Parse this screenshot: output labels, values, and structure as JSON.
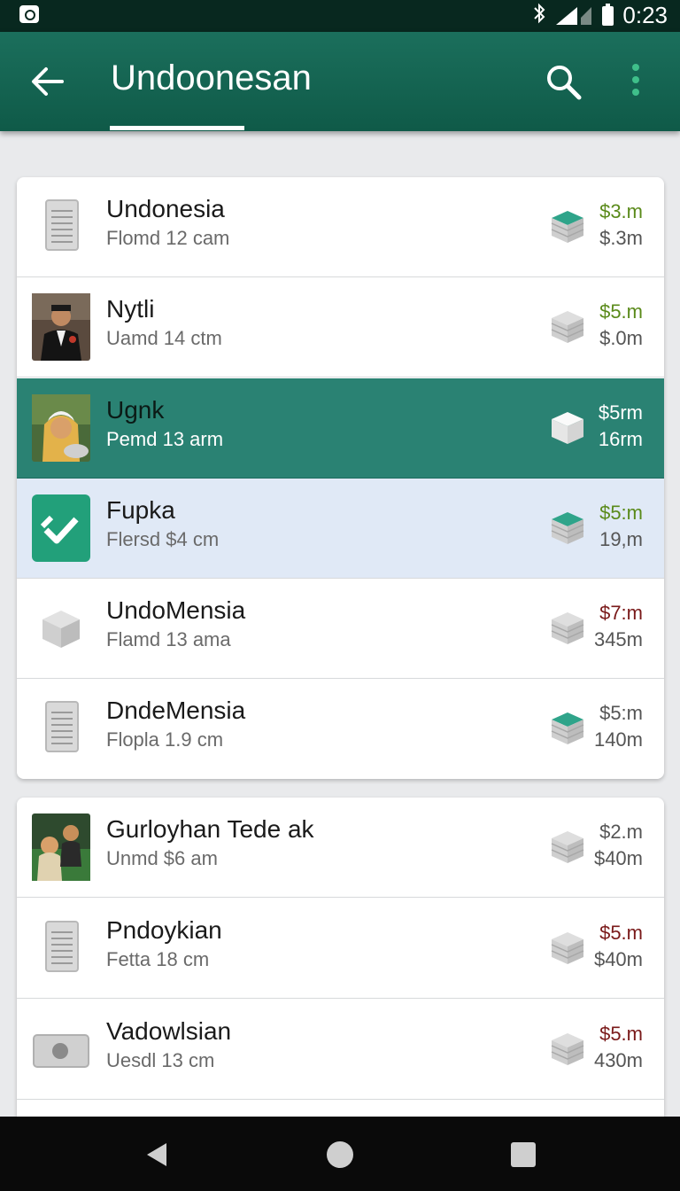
{
  "status_bar": {
    "time": "0:23"
  },
  "app_bar": {
    "title": "Undoonesan"
  },
  "colors": {
    "primary": "#0f5a48",
    "selected_row": "#2a8273",
    "highlight_row": "#e0e9f6",
    "value_green": "#5a8a1a",
    "value_red": "#7a1a1a"
  },
  "lists": [
    {
      "items": [
        {
          "name": "Undonesia",
          "sub": "Flomd 12 cam",
          "value_top": "$3.m",
          "value_bottom": "$.3m",
          "thumb": "document-icon",
          "value_color": "green"
        },
        {
          "name": "Nytli",
          "sub": "Uamd 14 ctm",
          "value_top": "$5.m",
          "value_bottom": "$.0m",
          "thumb": "photo-man-suit",
          "value_color": "green"
        },
        {
          "name": "Ugnk",
          "sub": "Pemd 13 arm",
          "value_top": "$5rm",
          "value_bottom": "16rm",
          "thumb": "photo-woman-hijab",
          "value_color": "white"
        },
        {
          "name": "Fupka",
          "sub": "Flersd $4 cm",
          "value_top": "$5:m",
          "value_bottom": "19,m",
          "thumb": "check-app-icon",
          "value_color": "green"
        },
        {
          "name": "UndoMensia",
          "sub": "Flamd 13 ama",
          "value_top": "$7:m",
          "value_bottom": "345m",
          "thumb": "cube-icon",
          "value_color": "red"
        },
        {
          "name": "DndeMensia",
          "sub": "Flopla 1.9 cm",
          "value_top": "$5:m",
          "value_bottom": "140m",
          "thumb": "document-icon",
          "value_color": "gray"
        }
      ]
    },
    {
      "items": [
        {
          "name": "Gurloyhan Tede ak",
          "sub": "Unmd $6 am",
          "value_top": "$2.m",
          "value_bottom": "$40m",
          "thumb": "photo-couple",
          "value_color": "gray"
        },
        {
          "name": "Pndoykian",
          "sub": "Fetta 18 cm",
          "value_top": "$5.m",
          "value_bottom": "$40m",
          "thumb": "document-icon",
          "value_color": "red"
        },
        {
          "name": "Vadowlsian",
          "sub": "Uesdl 13 cm",
          "value_top": "$5.m",
          "value_bottom": "430m",
          "thumb": "card-icon",
          "value_color": "red"
        }
      ]
    }
  ],
  "nav": {
    "back": "back-icon",
    "home": "home-icon",
    "recents": "recents-icon"
  }
}
